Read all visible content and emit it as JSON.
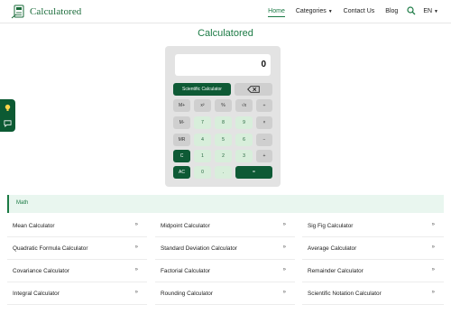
{
  "header": {
    "brand": "Calculatored",
    "nav": {
      "home": "Home",
      "categories": "Categories",
      "contact": "Contact Us",
      "blog": "Blog",
      "language": "EN"
    }
  },
  "side_float": {
    "icons": [
      "lightbulb-icon",
      "chat-icon"
    ]
  },
  "calculator": {
    "title": "Calculatored",
    "display_value": "0",
    "scientific_label": "Scientific Calculator",
    "keys": {
      "mplus": "M+",
      "x2": "x²",
      "percent": "%",
      "sqrt": "√x",
      "div": "÷",
      "mminus": "M-",
      "n7": "7",
      "n8": "8",
      "n9": "9",
      "mul": "×",
      "mr": "MR",
      "n4": "4",
      "n5": "5",
      "n6": "6",
      "minus": "−",
      "c": "C",
      "n1": "1",
      "n2": "2",
      "n3": "3",
      "plus": "+",
      "ac": "AC",
      "n0": "0",
      "dot": ".",
      "eq": "="
    }
  },
  "section": {
    "title": "Math",
    "chevron": "»",
    "items": [
      "Mean Calculator",
      "Midpoint Calculator",
      "Sig Fig Calculator",
      "Quadratic Formula Calculator",
      "Standard Deviation Calculator",
      "Average Calculator",
      "Covariance Calculator",
      "Factorial Calculator",
      "Remainder Calculator",
      "Integral Calculator",
      "Rounding Calculator",
      "Scientific Notation Calculator"
    ]
  },
  "colors": {
    "accent": "#1b7a44",
    "dark_key": "#0e5a35",
    "light_key": "#d8eedb",
    "gray_key": "#cfcfcf",
    "section_bg": "#e9f6ef"
  }
}
